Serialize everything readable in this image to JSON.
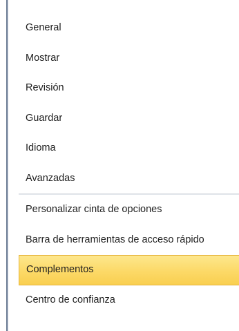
{
  "options_nav": {
    "group_1": [
      {
        "label": "General"
      },
      {
        "label": "Mostrar"
      },
      {
        "label": "Revisión"
      },
      {
        "label": "Guardar"
      },
      {
        "label": "Idioma"
      },
      {
        "label": "Avanzadas"
      }
    ],
    "group_2": [
      {
        "label": "Personalizar cinta de opciones"
      },
      {
        "label": "Barra de herramientas de acceso rápido"
      }
    ],
    "group_3": [
      {
        "label": "Complementos",
        "selected": true
      },
      {
        "label": "Centro de confianza"
      }
    ]
  },
  "colors": {
    "selected_background": "#fcd967",
    "selected_border": "#e5b43c",
    "text": "#1e1e1e",
    "window_edge": "#6e7e96"
  }
}
